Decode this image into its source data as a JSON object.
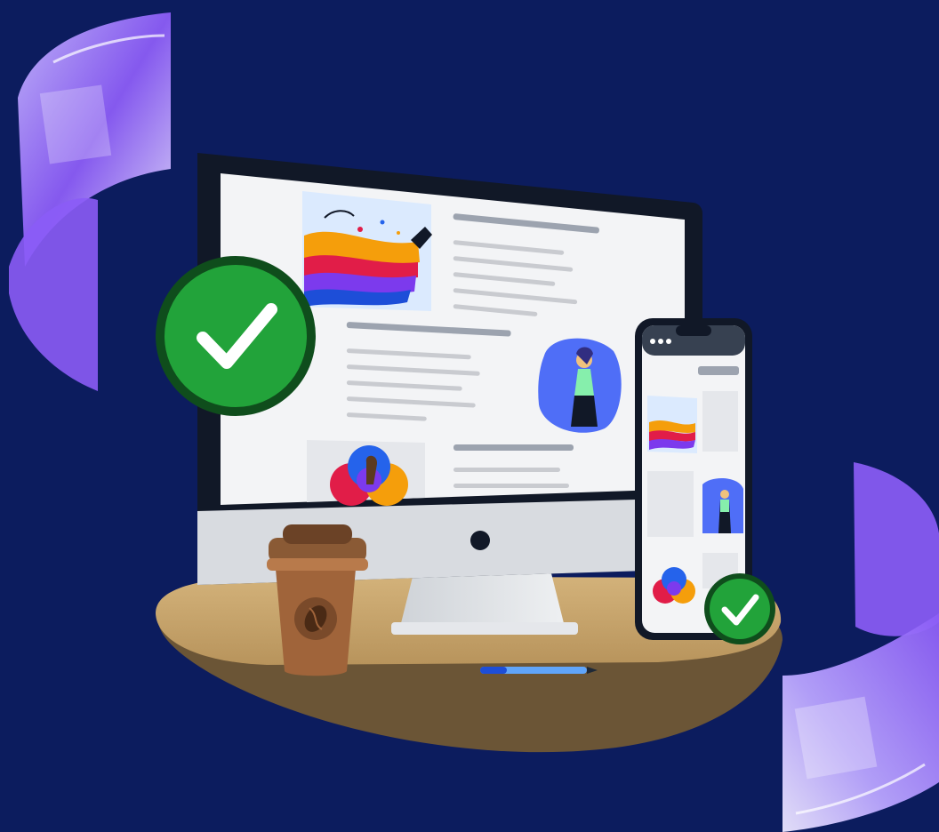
{
  "scene": {
    "background": "#0c1d5e",
    "accent_violet": "#a78bfa",
    "check_green": "#22a33a",
    "check_ring": "#0f4d1c",
    "desk_color": "#c9a66b",
    "desk_shadow": "#6b5536",
    "monitor_bezel": "#111827",
    "screen_bg": "#f3f4f6",
    "text_line_color": "#c9cbd0",
    "heading_line_color": "#9ca3af",
    "cup_color": "#a0643a",
    "lid_color": "#8a5a35"
  },
  "icons": [
    "ribbon-decoration-icon",
    "checkmark-badge-icon",
    "coffee-cup-icon",
    "coffee-bean-icon",
    "pen-icon",
    "paint-swirl-icon",
    "woman-figure-icon",
    "color-palette-icon",
    "smartphone-icon"
  ]
}
